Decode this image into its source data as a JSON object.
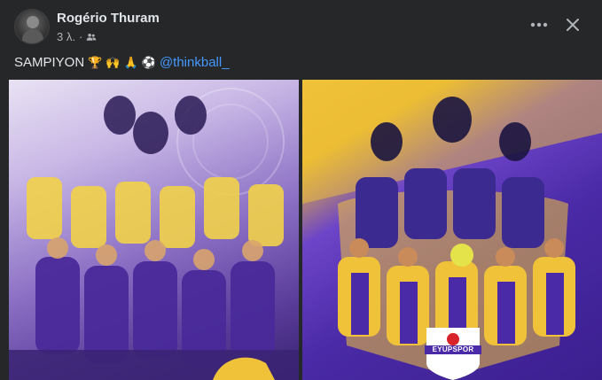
{
  "post": {
    "author": "Rogério Thuram",
    "time": "3 λ.",
    "separator": "·",
    "audience_icon": "friends-icon",
    "caption_text": "SAMPIYON",
    "caption_emojis": [
      "🏆",
      "🙌",
      "🙏",
      "⚽"
    ],
    "mention": "@thinkball_"
  },
  "actions": {
    "more_icon": "more-horizontal-icon",
    "close_icon": "close-icon"
  },
  "media": {
    "left_image": "celebration-poster-left",
    "right_image": "celebration-poster-right",
    "right_logo_text": "EYÜPSPOR"
  },
  "colors": {
    "background": "#252728",
    "text_primary": "#e2e5e9",
    "text_secondary": "#b0b3b8",
    "mention": "#4599ff",
    "team_purple": "#5a3c9a",
    "team_yellow": "#f0c23a"
  }
}
